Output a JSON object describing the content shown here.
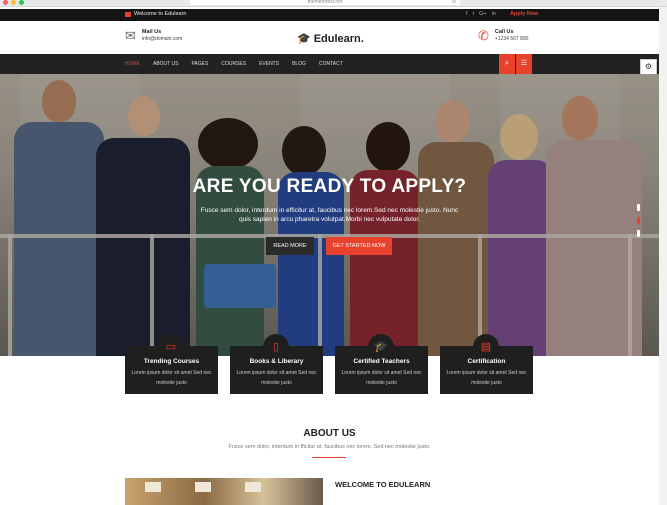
{
  "browser": {
    "url": "themeforest.net",
    "controls": [
      "#ff5f57",
      "#febc2e",
      "#28c840"
    ]
  },
  "topbar": {
    "welcome": "Welcome to Edulearn",
    "social": [
      "f",
      "t",
      "G+",
      "in"
    ],
    "apply": "Apply Now"
  },
  "header": {
    "mail": {
      "title": "Mail Us",
      "value": "info@domain.com",
      "icon": "envelope-icon"
    },
    "logo": "Edulearn.",
    "call": {
      "title": "Call Us",
      "value": "+1234 567 890",
      "icon": "phone-icon"
    }
  },
  "nav": {
    "items": [
      "HOME",
      "ABOUT US",
      "PAGES",
      "COURSES",
      "EVENTS",
      "BLOG",
      "CONTACT"
    ],
    "active": "HOME"
  },
  "hero": {
    "title": "ARE YOU READY TO APPLY?",
    "subtitle": "Fusce sem dolor, interdum in efficitur at, faucibus nec lorem.Sed nec molestie justo. Nunc quis sapien in arcu pharetra volutpat.Morbi nec vulputate dolor.",
    "btn_primary": "READ MORE",
    "btn_secondary": "GET STARTED NOW"
  },
  "features": [
    {
      "title": "Trending Courses",
      "desc": "Lorem ipsum dolor sit amet Sed nec molestie justo",
      "icon": "monitor-icon"
    },
    {
      "title": "Books & Liberary",
      "desc": "Lorem ipsum dolor sit amet Sed nec molestie justo",
      "icon": "book-icon"
    },
    {
      "title": "Certified Teachers",
      "desc": "Lorem ipsum dolor sit amet Sed nec molestie justo",
      "icon": "graduation-cap-icon"
    },
    {
      "title": "Certification",
      "desc": "Lorem ipsum dolor sit amet Sed nec molestie justo",
      "icon": "certificate-icon"
    }
  ],
  "about": {
    "title": "ABOUT US",
    "subtitle": "Fusce sem dolor, interdum in fficitur at, faucibus nec lorem. Sed nec molestie justo.",
    "welcome": "WELCOME TO EDULEARN"
  },
  "colors": {
    "accent": "#e8412c",
    "dark": "#222222"
  }
}
